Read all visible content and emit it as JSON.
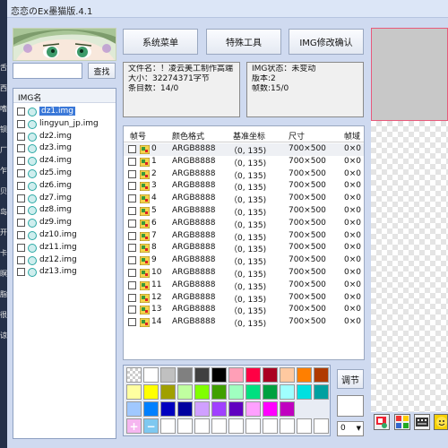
{
  "window": {
    "title": "恋恋のEx墨猫版.4.1"
  },
  "desktop_strip": [
    "舌",
    "西",
    "嗜",
    "钡",
    "厂",
    "乍",
    "贝",
    "岛",
    "开",
    "卡",
    "瞑",
    "脂",
    "很",
    "谅"
  ],
  "search": {
    "value": "",
    "button": "查找"
  },
  "top_buttons": {
    "system_menu": "系统菜单",
    "special_tools": "特殊工具",
    "img_confirm": "IMG修改确认"
  },
  "file_info": {
    "filename": "文件名：！凌云美工制作高端",
    "size": "大小：32274371字节",
    "count": "条目数：14/0"
  },
  "img_info": {
    "status": "IMG状态：未变动",
    "version": "版本:2",
    "frames": "帧数:15/0"
  },
  "img_list": {
    "header": "IMG名",
    "items": [
      "dz1.img",
      "lingyun_jp.img",
      "dz2.img",
      "dz3.img",
      "dz4.img",
      "dz5.img",
      "dz6.img",
      "dz7.img",
      "dz8.img",
      "dz9.img",
      "dz10.img",
      "dz11.img",
      "dz12.img",
      "dz13.img"
    ],
    "selected_index": 0
  },
  "frames_table": {
    "columns": [
      "帧号",
      "颜色格式",
      "基准坐标",
      "尺寸",
      "帧域"
    ],
    "rows": [
      {
        "id": "0",
        "format": "ARGB8888",
        "coord": "（0, 135)",
        "size": "700×500",
        "extra": "0×0"
      },
      {
        "id": "1",
        "format": "ARGB8888",
        "coord": "（0, 135)",
        "size": "700×500",
        "extra": "0×0"
      },
      {
        "id": "2",
        "format": "ARGB8888",
        "coord": "（0, 135)",
        "size": "700×500",
        "extra": "0×0"
      },
      {
        "id": "3",
        "format": "ARGB8888",
        "coord": "（0, 135)",
        "size": "700×500",
        "extra": "0×0"
      },
      {
        "id": "4",
        "format": "ARGB8888",
        "coord": "（0, 135)",
        "size": "700×500",
        "extra": "0×0"
      },
      {
        "id": "5",
        "format": "ARGB8888",
        "coord": "（0, 135)",
        "size": "700×500",
        "extra": "0×0"
      },
      {
        "id": "6",
        "format": "ARGB8888",
        "coord": "（0, 135)",
        "size": "700×500",
        "extra": "0×0"
      },
      {
        "id": "7",
        "format": "ARGB8888",
        "coord": "（0, 135)",
        "size": "700×500",
        "extra": "0×0"
      },
      {
        "id": "8",
        "format": "ARGB8888",
        "coord": "（0, 135)",
        "size": "700×500",
        "extra": "0×0"
      },
      {
        "id": "9",
        "format": "ARGB8888",
        "coord": "（0, 135)",
        "size": "700×500",
        "extra": "0×0"
      },
      {
        "id": "10",
        "format": "ARGB8888",
        "coord": "（0, 135)",
        "size": "700×500",
        "extra": "0×0"
      },
      {
        "id": "11",
        "format": "ARGB8888",
        "coord": "（0, 135)",
        "size": "700×500",
        "extra": "0×0"
      },
      {
        "id": "12",
        "format": "ARGB8888",
        "coord": "（0, 135)",
        "size": "700×500",
        "extra": "0×0"
      },
      {
        "id": "13",
        "format": "ARGB8888",
        "coord": "（0, 135)",
        "size": "700×500",
        "extra": "0×0"
      },
      {
        "id": "14",
        "format": "ARGB8888",
        "coord": "（0, 135)",
        "size": "700×500",
        "extra": "0×0"
      }
    ],
    "highlighted_index": 0
  },
  "palette": {
    "row1": [
      "transparent",
      "#ffffff",
      "#c0c0c0",
      "#808080",
      "#404040",
      "#000000",
      "#ff9fb7",
      "#ff0044",
      "#aa0022",
      "#ffc9a0",
      "#ff7f00",
      "#b03a00"
    ],
    "row2": [
      "#ffffa0",
      "#ffff00",
      "#a0a000",
      "#c0ffa0",
      "#80ff00",
      "#40a000",
      "#a0ffc0",
      "#00e080",
      "#00a040",
      "#a0ffff",
      "#00e0e0",
      "#00a0a0"
    ],
    "row3": [
      "#a0c8ff",
      "#0080ff",
      "#0000c0",
      "#0000a0",
      "#d0a0ff",
      "#a040ff",
      "#6000c0",
      "#ffa0ff",
      "#ff00ff",
      "#c000c0"
    ],
    "row4_buttons": [
      "+",
      "−"
    ],
    "adjust_button": "调节"
  },
  "zoom": {
    "value": "0"
  },
  "tool_icons": [
    "flag-tool-icon",
    "grid-tool-icon",
    "film-tool-icon",
    "paint-tool-icon"
  ]
}
